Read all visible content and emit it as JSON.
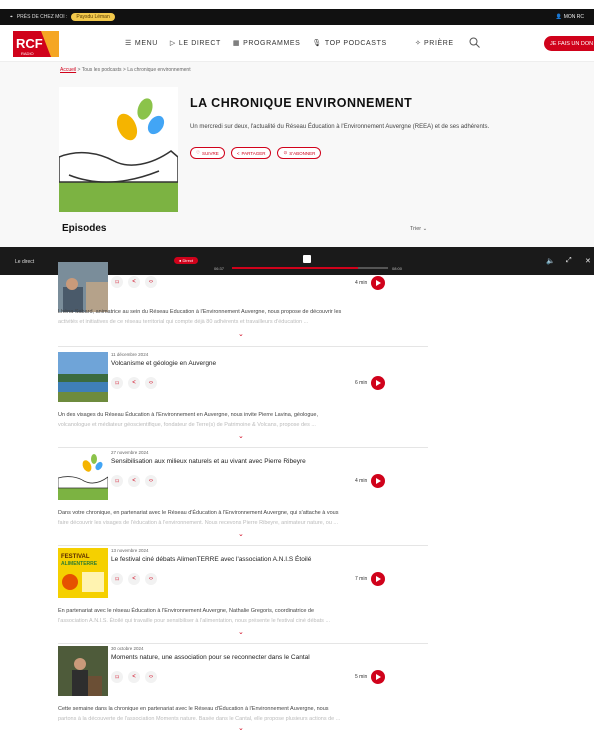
{
  "topbar": {
    "left_text": "PRÈS DE CHEZ MOI :",
    "pill": "Paysdu Léman",
    "right_text": "MON RC"
  },
  "header": {
    "nav": [
      "MENU",
      "LE DIRECT",
      "PROGRAMMES",
      "TOP PODCASTS"
    ],
    "priere": "PRIÈRE",
    "don": "JE FAIS UN DON"
  },
  "breadcrumb": {
    "home": "Accueil",
    "sep1": ">",
    "crumb2": "Tous les podcasts",
    "sep2": ">",
    "crumb3": "La chronique environnement"
  },
  "podcast": {
    "title": "LA CHRONIQUE ENVIRONNEMENT",
    "description": "Un mercredi sur deux, l'actualité du Réseau Éducation à l'Environnement Auvergne (REEA) et de ses adhérents.",
    "actions": [
      "SUIVRE",
      "PARTAGER",
      "S'ABONNER"
    ]
  },
  "episodes_heading": "Episodes",
  "sort_label": "Trier",
  "player": {
    "label": "Le direct",
    "badge": "Direct",
    "time_start": "06:37",
    "time_end": "08:00",
    "progress": 0.81
  },
  "episodes": [
    {
      "date": "",
      "title": "",
      "duration": "4 min",
      "text1": "Lhéna Sabard, animatrice au sein du Réseau Education à l'Environnement Auvergne, nous propose de découvrir les",
      "text2": "activités et initiatives de ce réseau territorial qui compte déjà 80 adhérents et travailleurs d'éducation ..."
    },
    {
      "date": "11 décembre 2024",
      "title": "Volcanisme et géologie en Auvergne",
      "duration": "6 min",
      "text1": "Un des visages du Réseau Éducation à l'Environnement en Auvergne, nous invite Pierre Lavina, géologue,",
      "text2": "volcanologue et médiateur géoscientifique, fondateur de Terre(s) de Patrimoine & Volcans, propose des ..."
    },
    {
      "date": "27 novembre 2024",
      "title": "Sensibilisation aux milieux naturels et au vivant avec Pierre Ribeyre",
      "duration": "4 min",
      "text1": "Dans votre chronique, en partenariat avec le Réseau d'Éducation à l'Environnement Auvergne, qui s'attache à vous",
      "text2": "faire découvrir les visages de l'éducation à l'environnement. Nous recevons Pierre Ribeyre, animateur nature, ou ..."
    },
    {
      "date": "13 novembre 2024",
      "title": "Le festival ciné débats AlimenTERRE avec l'association A.N.I.S Étoilé",
      "duration": "7 min",
      "text1": "En partenariat avec le réseau Éducation à l'Environnement Auvergne, Nathalie Gregoris, coordinatrice de",
      "text2": "l'association A.N.I.S. Étoilé qui travaille pour sensibiliser à l'alimentation, nous présente le festival ciné débats ..."
    },
    {
      "date": "30 octobre 2024",
      "title": "Moments nature, une association pour se reconnecter dans le Cantal",
      "duration": "5 min",
      "text1": "Cette semaine dans la chronique en partenariat avec le Réseau d'Éducation à l'Environnement Auvergne, nous",
      "text2": "partons à la découverte de l'association Moments nature. Basée dans le Cantal, elle propose plusieurs actions de ..."
    }
  ],
  "festival_art": {
    "line1": "FESTIVAL",
    "line2": "ALIMENTERRE"
  },
  "colors": {
    "accent": "#d0021b",
    "topbar": "#111111",
    "player": "#1a1a1a"
  }
}
